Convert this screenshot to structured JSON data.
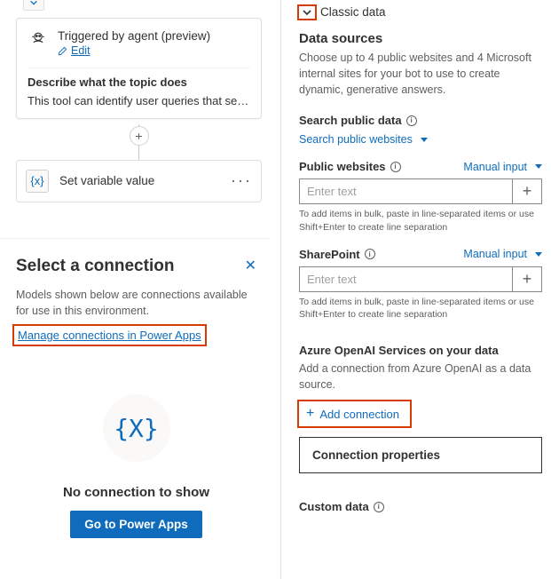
{
  "left": {
    "trigger": {
      "title": "Triggered by agent (preview)",
      "edit": "Edit",
      "describe_heading": "Describe what the topic does",
      "describe_text": "This tool can identify user queries that seek f…"
    },
    "set_variable": "Set variable value"
  },
  "connection": {
    "title": "Select a connection",
    "sub": "Models shown below are connections available for use in this environment.",
    "manage": "Manage connections in Power Apps",
    "no_conn": "No connection to show",
    "go_btn": "Go to Power Apps",
    "placeholder_glyph": "{X}"
  },
  "right": {
    "classic": "Classic data",
    "data_sources_title": "Data sources",
    "data_sources_help": "Choose up to 4 public websites and 4 Microsoft internal sites for your bot to use to create dynamic, generative answers.",
    "search_public_label": "Search public data",
    "search_public_link": "Search public websites",
    "public_websites_label": "Public websites",
    "manual_input": "Manual input",
    "enter_text": "Enter text",
    "bulk_hint": "To add items in bulk, paste in line-separated items or use Shift+Enter to create line separation",
    "sharepoint_label": "SharePoint",
    "azure_title": "Azure OpenAI Services on your data",
    "azure_help": "Add a connection from Azure OpenAI as a data source.",
    "add_connection": "Add connection",
    "conn_props": "Connection properties",
    "custom_data": "Custom data"
  }
}
